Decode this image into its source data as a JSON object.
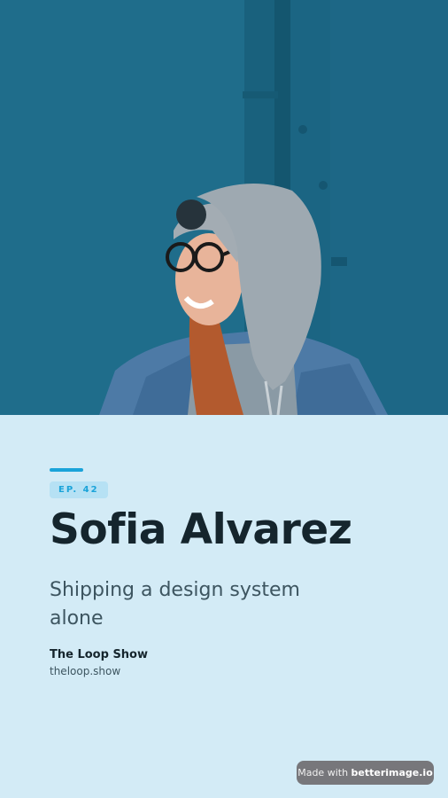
{
  "hero": {
    "photo": "portrait-photo"
  },
  "episode": {
    "badge": "EP. 42"
  },
  "guest": {
    "name": "Sofia Alvarez"
  },
  "talk": {
    "title": "Shipping a design system alone"
  },
  "show": {
    "name": "The Loop Show",
    "url": "theloop.show"
  },
  "watermark": {
    "prefix": "Made with ",
    "brand": "betterimage.io"
  },
  "colors": {
    "accent": "#1aa3d9",
    "background": "#d3ebf6",
    "hero_bg": "#1e6a88"
  }
}
